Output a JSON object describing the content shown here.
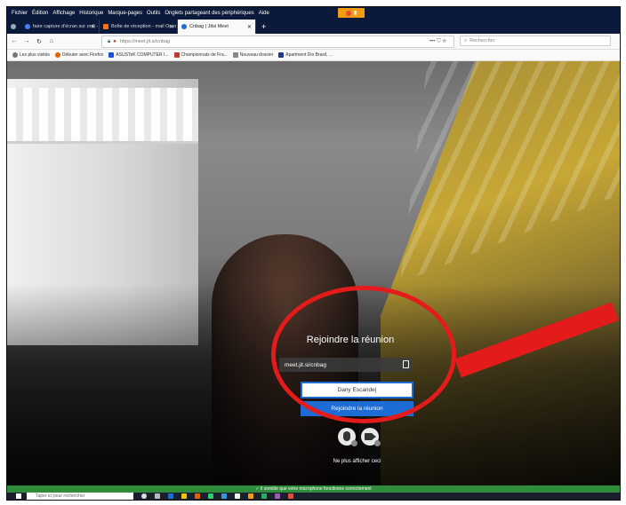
{
  "menubar": {
    "items": [
      "Fichier",
      "Édition",
      "Affichage",
      "Historique",
      "Marque-pages",
      "Outils",
      "Onglets partageant des périphériques",
      "Aide"
    ]
  },
  "tabs": [
    {
      "label": "faire capture d'écran sur ordi -",
      "icon_color": "#3b82f6"
    },
    {
      "label": "Boîte de réception - mail Oran",
      "icon_color": "#f97316"
    },
    {
      "label": "Cnbag | Jitsi Meet",
      "icon_color": "#1d6cd4",
      "active": true
    }
  ],
  "navbar": {
    "url": "https://meet.jit.si/cnbag",
    "actions": "••• ⛉ ☆",
    "search_placeholder": "Rechercher"
  },
  "bookmarks": [
    {
      "label": "Les plus visités",
      "icon_color": "#777777"
    },
    {
      "label": "Débuter avec Firefox",
      "icon_color": "#e66000"
    },
    {
      "label": "ASUSTeK COMPUTER I...",
      "icon_color": "#1d4ed8"
    },
    {
      "label": "Championnats de Fra...",
      "icon_color": "#c0392b"
    },
    {
      "label": "Nouveau dossier",
      "icon_color": "#888888"
    },
    {
      "label": "Apartment Dio Brasil, ...",
      "icon_color": "#1e3a8a"
    }
  ],
  "prejoin": {
    "title": "Rejoindre la réunion",
    "meeting_url": "meet.jit.si/cnbag",
    "name_value": "Dany Escande",
    "join_label": "Rejoindre la réunion",
    "hide_label": "Ne plus afficher ceci"
  },
  "status_banner": "✓ Il semble que votre microphone fonctionne correctement",
  "taskbar": {
    "search_placeholder": "Taper ici pour rechercher"
  },
  "colors": {
    "accent": "#1d6cd4",
    "annotation": "#e41b1b",
    "banner": "#2f8c3a"
  }
}
